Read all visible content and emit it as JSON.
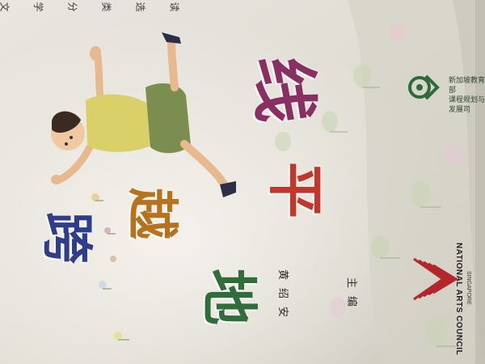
{
  "book": {
    "series": [
      "文",
      "学",
      "分",
      "类",
      "选",
      "读"
    ],
    "title": [
      "跨",
      "越",
      "地",
      "平",
      "线"
    ],
    "editor_name": [
      "黄",
      "绍",
      "安"
    ],
    "editor_role": [
      "主",
      "编"
    ],
    "publisher_moe_lines": [
      "新加坡教育部",
      "课程规划与发展司"
    ],
    "arts_council": "NATIONAL ARTS COUNCIL",
    "arts_council_sub": "SINGAPORE"
  },
  "colors": {
    "title_1": "#2f3e8c",
    "title_2": "#b8721d",
    "title_3": "#2f6e3a",
    "title_4": "#c2372c",
    "title_5": "#8a2f62",
    "arts_council_red": "#b3262b"
  }
}
